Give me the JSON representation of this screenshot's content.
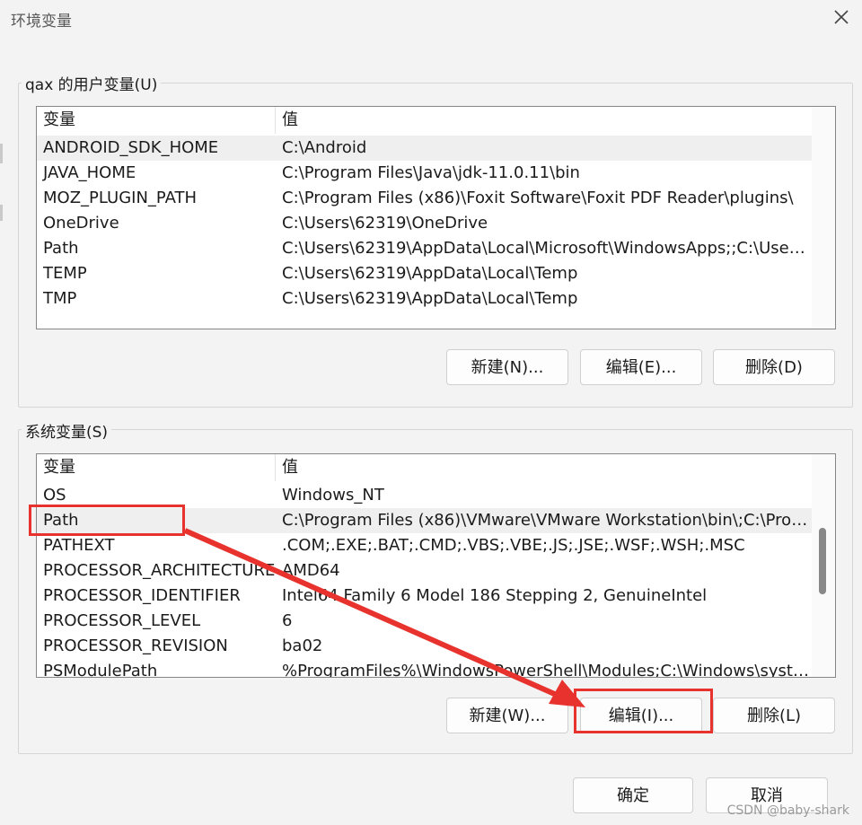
{
  "window": {
    "title": "环境变量",
    "close_icon": "close-icon"
  },
  "user_vars": {
    "label": "qax 的用户变量(U)",
    "header": {
      "name": "变量",
      "value": "值"
    },
    "rows": [
      {
        "name": "ANDROID_SDK_HOME",
        "value": "C:\\Android"
      },
      {
        "name": "JAVA_HOME",
        "value": "C:\\Program Files\\Java\\jdk-11.0.11\\bin"
      },
      {
        "name": "MOZ_PLUGIN_PATH",
        "value": "C:\\Program Files (x86)\\Foxit Software\\Foxit PDF Reader\\plugins\\"
      },
      {
        "name": "OneDrive",
        "value": "C:\\Users\\62319\\OneDrive"
      },
      {
        "name": "Path",
        "value": "C:\\Users\\62319\\AppData\\Local\\Microsoft\\WindowsApps;;C:\\Users\\..."
      },
      {
        "name": "TEMP",
        "value": "C:\\Users\\62319\\AppData\\Local\\Temp"
      },
      {
        "name": "TMP",
        "value": "C:\\Users\\62319\\AppData\\Local\\Temp"
      }
    ],
    "buttons": {
      "new": "新建(N)...",
      "edit": "编辑(E)...",
      "delete": "删除(D)"
    }
  },
  "system_vars": {
    "label": "系统变量(S)",
    "header": {
      "name": "变量",
      "value": "值"
    },
    "rows": [
      {
        "name": "OS",
        "value": "Windows_NT"
      },
      {
        "name": "Path",
        "value": "C:\\Program Files (x86)\\VMware\\VMware Workstation\\bin\\;C:\\Prog..."
      },
      {
        "name": "PATHEXT",
        "value": ".COM;.EXE;.BAT;.CMD;.VBS;.VBE;.JS;.JSE;.WSF;.WSH;.MSC"
      },
      {
        "name": "PROCESSOR_ARCHITECTURE",
        "value": "AMD64"
      },
      {
        "name": "PROCESSOR_IDENTIFIER",
        "value": "Intel64 Family 6 Model 186 Stepping 2, GenuineIntel"
      },
      {
        "name": "PROCESSOR_LEVEL",
        "value": "6"
      },
      {
        "name": "PROCESSOR_REVISION",
        "value": "ba02"
      },
      {
        "name": "PSModulePath",
        "value": "%ProgramFiles%\\WindowsPowerShell\\Modules;C:\\Windows\\syste..."
      }
    ],
    "buttons": {
      "new": "新建(W)...",
      "edit": "编辑(I)...",
      "delete": "删除(L)"
    }
  },
  "footer": {
    "ok": "确定",
    "cancel": "取消"
  },
  "watermark": "CSDN @baby-shark",
  "annotation_color": "#e8322e"
}
